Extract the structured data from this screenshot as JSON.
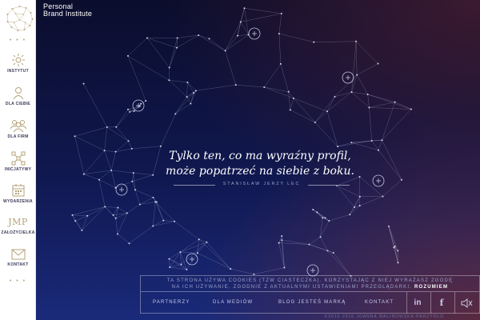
{
  "brand": {
    "line1": "Personal",
    "line2": "Brand Institute"
  },
  "sidebar": {
    "items": [
      {
        "label": "INSTYTUT",
        "icon": "sun-icon"
      },
      {
        "label": "DLA CIEBIE",
        "icon": "person-icon"
      },
      {
        "label": "DLA FIRM",
        "icon": "group-icon"
      },
      {
        "label": "INICJATYWY",
        "icon": "network-icon"
      },
      {
        "label": "WYDARZENIA",
        "icon": "calendar-icon"
      },
      {
        "label": "ZAŁOŻYCIELKA",
        "icon": "jmp-monogram",
        "monogram": "JMP"
      },
      {
        "label": "KONTAKT",
        "icon": "envelope-icon"
      }
    ],
    "dots": "• • •"
  },
  "quote": {
    "line1": "Tylko ten, co ma wyraźny profil,",
    "line2": "może popatrzeć na siebie z boku.",
    "author": "STANISŁAW JERZY LEC"
  },
  "cookie": {
    "text1": "TA STRONA UŻYWA COOKIES (TZW CIASTECZKA). KORZYSTAJĄC Z NIEJ WYRAŻASZ ZGODĘ",
    "text2": "NA ICH UŻYWANIE, ZGODNIE Z AKTUALNYMI USTAWIENIAMI PRZEGLĄDARKI.",
    "accept": "ROZUMIEM"
  },
  "footer": {
    "links": [
      "PARTNERZY",
      "DLA MEDIÓW",
      "BLOG JESTEŚ MARKĄ",
      "KONTAKT"
    ],
    "linkedin": "in",
    "facebook": "f",
    "copyright": "©2015-2016 JOANNA MALINOWSKA-PARZYDŁO"
  },
  "colors": {
    "accent": "#b5a37a",
    "navText": "#3a3a5a",
    "background": "#0d0f30"
  }
}
